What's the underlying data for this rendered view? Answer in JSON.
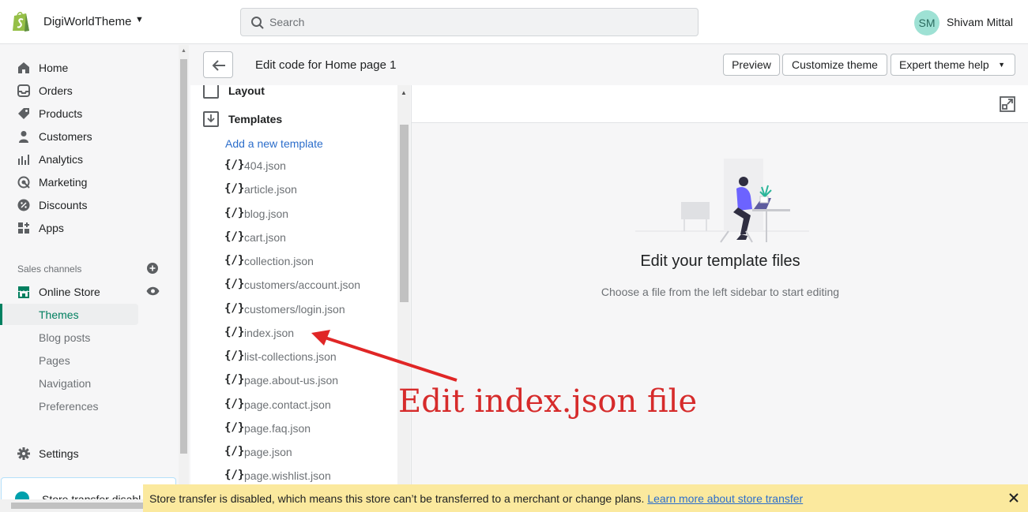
{
  "topbar": {
    "store_name": "DigiWorldTheme",
    "search_placeholder": "Search",
    "avatar_initials": "SM",
    "user_name": "Shivam Mittal"
  },
  "sidebar": {
    "items": [
      {
        "label": "Home",
        "icon": "home-icon"
      },
      {
        "label": "Orders",
        "icon": "orders-icon"
      },
      {
        "label": "Products",
        "icon": "tag-icon"
      },
      {
        "label": "Customers",
        "icon": "person-icon"
      },
      {
        "label": "Analytics",
        "icon": "bar-chart-icon"
      },
      {
        "label": "Marketing",
        "icon": "target-icon"
      },
      {
        "label": "Discounts",
        "icon": "discount-icon"
      },
      {
        "label": "Apps",
        "icon": "apps-icon"
      }
    ],
    "sales_channels_label": "Sales channels",
    "online_store_label": "Online Store",
    "sub_items": [
      "Themes",
      "Blog posts",
      "Pages",
      "Navigation",
      "Preferences"
    ],
    "active_sub": "Themes",
    "settings_label": "Settings",
    "transfer_card_text": "Store transfer disabl"
  },
  "header": {
    "title_prefix": "Edit code for ",
    "title_page": "Home page 1",
    "preview_label": "Preview",
    "customize_label": "Customize theme",
    "expert_label": "Expert theme help"
  },
  "filetree": {
    "layout_label": "Layout",
    "templates_label": "Templates",
    "add_template_label": "Add a new template",
    "file_icon_glyph": "{/}",
    "files": [
      "404.json",
      "article.json",
      "blog.json",
      "cart.json",
      "collection.json",
      "customers/account.json",
      "customers/login.json",
      "index.json",
      "list-collections.json",
      "page.about-us.json",
      "page.contact.json",
      "page.faq.json",
      "page.json",
      "page.wishlist.json"
    ]
  },
  "editor": {
    "empty_title": "Edit your template files",
    "empty_subtitle": "Choose a file from the left sidebar to start editing"
  },
  "annotation": {
    "text": "Edit index.json file",
    "color": "#d62b2b"
  },
  "banner": {
    "message": "Store transfer is disabled, which means this store can’t be transferred to a merchant or change plans. ",
    "link_text": "Learn more about store transfer"
  },
  "colors": {
    "accent": "#008060",
    "link": "#2c6ecb",
    "banner_bg": "#fbe99e"
  }
}
